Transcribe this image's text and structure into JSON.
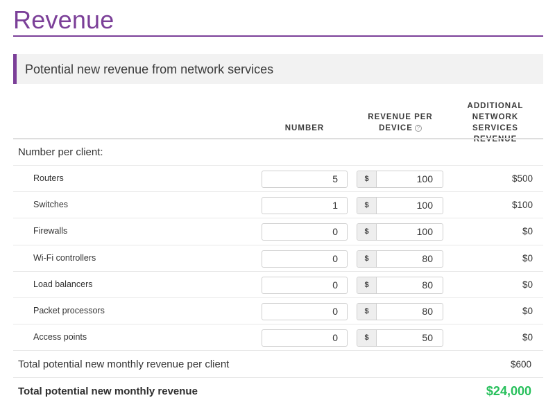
{
  "page": {
    "title": "Revenue",
    "section_title": "Potential new revenue from network services"
  },
  "columns": {
    "number": "NUMBER",
    "revenue_per_device_line1": "REVENUE PER",
    "revenue_per_device_line2": "DEVICE",
    "help_glyph": "?",
    "additional_line1": "ADDITIONAL",
    "additional_line2": "NETWORK",
    "additional_line3": "SERVICES REVENUE"
  },
  "group": {
    "label": "Number per client:"
  },
  "currency_symbol": "$",
  "items": [
    {
      "label": "Routers",
      "number": "5",
      "revenue": "100",
      "total": "$500"
    },
    {
      "label": "Switches",
      "number": "1",
      "revenue": "100",
      "total": "$100"
    },
    {
      "label": "Firewalls",
      "number": "0",
      "revenue": "100",
      "total": "$0"
    },
    {
      "label": "Wi-Fi controllers",
      "number": "0",
      "revenue": "80",
      "total": "$0"
    },
    {
      "label": "Load balancers",
      "number": "0",
      "revenue": "80",
      "total": "$0"
    },
    {
      "label": "Packet processors",
      "number": "0",
      "revenue": "80",
      "total": "$0"
    },
    {
      "label": "Access points",
      "number": "0",
      "revenue": "50",
      "total": "$0"
    }
  ],
  "totals": {
    "per_client_label": "Total potential new monthly revenue per client",
    "per_client_value": "$600",
    "grand_label": "Total potential new monthly revenue",
    "grand_value": "$24,000"
  },
  "colors": {
    "accent": "#7b3f98",
    "total_green": "#28c05c",
    "section_bg": "#f2f2f2"
  }
}
